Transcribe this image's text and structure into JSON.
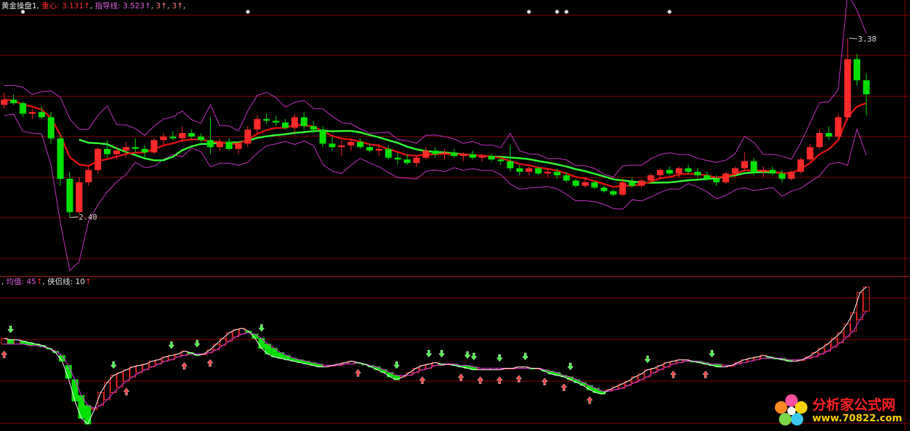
{
  "chart_data": [
    {
      "type": "candlestick",
      "header": {
        "title": "黄金操盘1",
        "items": [
          {
            "label": "重心",
            "value": "3.131",
            "arrow": "↑"
          },
          {
            "label": "指导线",
            "value": "3.523",
            "arrow": "↑"
          },
          {
            "label": "",
            "value": "3",
            "arrow": "↑"
          },
          {
            "label": "",
            "value": "3",
            "arrow": "↑"
          }
        ]
      },
      "annotations": {
        "low": "2.40",
        "high": "3.38"
      },
      "ylim": [
        2.1,
        3.55
      ],
      "grid": true,
      "ohlc": [
        [
          3.04,
          3.11,
          3.02,
          3.07
        ],
        [
          3.07,
          3.1,
          3.04,
          3.05
        ],
        [
          3.05,
          3.06,
          2.97,
          2.99
        ],
        [
          2.99,
          3.02,
          2.96,
          3.0
        ],
        [
          3.0,
          3.03,
          2.96,
          2.97
        ],
        [
          2.97,
          3.0,
          2.82,
          2.85
        ],
        [
          2.85,
          2.87,
          2.58,
          2.62
        ],
        [
          2.62,
          2.66,
          2.4,
          2.43
        ],
        [
          2.43,
          2.63,
          2.42,
          2.6
        ],
        [
          2.6,
          2.7,
          2.58,
          2.67
        ],
        [
          2.67,
          2.8,
          2.65,
          2.79
        ],
        [
          2.79,
          2.84,
          2.74,
          2.76
        ],
        [
          2.76,
          2.8,
          2.73,
          2.78
        ],
        [
          2.78,
          2.83,
          2.74,
          2.8
        ],
        [
          2.8,
          2.85,
          2.77,
          2.79
        ],
        [
          2.79,
          2.81,
          2.74,
          2.77
        ],
        [
          2.77,
          2.85,
          2.76,
          2.84
        ],
        [
          2.84,
          2.88,
          2.81,
          2.86
        ],
        [
          2.86,
          2.89,
          2.84,
          2.85
        ],
        [
          2.85,
          2.92,
          2.83,
          2.88
        ],
        [
          2.88,
          2.9,
          2.85,
          2.86
        ],
        [
          2.86,
          2.88,
          2.83,
          2.84
        ],
        [
          2.84,
          2.97,
          2.76,
          2.8
        ],
        [
          2.8,
          2.85,
          2.78,
          2.83
        ],
        [
          2.83,
          2.85,
          2.78,
          2.79
        ],
        [
          2.79,
          2.83,
          2.76,
          2.82
        ],
        [
          2.82,
          2.92,
          2.8,
          2.9
        ],
        [
          2.9,
          2.98,
          2.88,
          2.96
        ],
        [
          2.96,
          2.99,
          2.93,
          2.95
        ],
        [
          2.95,
          2.98,
          2.92,
          2.94
        ],
        [
          2.94,
          2.96,
          2.9,
          2.91
        ],
        [
          2.91,
          2.99,
          2.88,
          2.97
        ],
        [
          2.97,
          3.0,
          2.9,
          2.92
        ],
        [
          2.92,
          2.95,
          2.88,
          2.9
        ],
        [
          2.9,
          2.92,
          2.8,
          2.82
        ],
        [
          2.82,
          2.86,
          2.78,
          2.8
        ],
        [
          2.8,
          2.84,
          2.75,
          2.81
        ],
        [
          2.81,
          2.85,
          2.78,
          2.83
        ],
        [
          2.83,
          2.85,
          2.79,
          2.8
        ],
        [
          2.8,
          2.82,
          2.77,
          2.78
        ],
        [
          2.78,
          2.82,
          2.75,
          2.79
        ],
        [
          2.79,
          2.81,
          2.73,
          2.74
        ],
        [
          2.74,
          2.77,
          2.7,
          2.73
        ],
        [
          2.73,
          2.76,
          2.7,
          2.71
        ],
        [
          2.71,
          2.75,
          2.69,
          2.74
        ],
        [
          2.74,
          2.8,
          2.73,
          2.78
        ],
        [
          2.78,
          2.8,
          2.74,
          2.76
        ],
        [
          2.76,
          2.79,
          2.73,
          2.77
        ],
        [
          2.77,
          2.79,
          2.74,
          2.75
        ],
        [
          2.75,
          2.77,
          2.72,
          2.76
        ],
        [
          2.76,
          2.78,
          2.73,
          2.74
        ],
        [
          2.74,
          2.76,
          2.72,
          2.75
        ],
        [
          2.75,
          2.76,
          2.72,
          2.73
        ],
        [
          2.73,
          2.74,
          2.7,
          2.72
        ],
        [
          2.72,
          2.81,
          2.66,
          2.68
        ],
        [
          2.68,
          2.7,
          2.64,
          2.66
        ],
        [
          2.66,
          2.69,
          2.64,
          2.68
        ],
        [
          2.68,
          2.69,
          2.64,
          2.65
        ],
        [
          2.65,
          2.68,
          2.63,
          2.66
        ],
        [
          2.66,
          2.68,
          2.62,
          2.64
        ],
        [
          2.64,
          2.66,
          2.6,
          2.61
        ],
        [
          2.61,
          2.62,
          2.57,
          2.58
        ],
        [
          2.58,
          2.62,
          2.57,
          2.6
        ],
        [
          2.6,
          2.61,
          2.56,
          2.57
        ],
        [
          2.57,
          2.58,
          2.54,
          2.55
        ],
        [
          2.55,
          2.56,
          2.52,
          2.53
        ],
        [
          2.53,
          2.62,
          2.52,
          2.6
        ],
        [
          2.6,
          2.63,
          2.57,
          2.58
        ],
        [
          2.58,
          2.62,
          2.57,
          2.61
        ],
        [
          2.61,
          2.65,
          2.6,
          2.64
        ],
        [
          2.64,
          2.68,
          2.62,
          2.67
        ],
        [
          2.67,
          2.69,
          2.64,
          2.65
        ],
        [
          2.65,
          2.69,
          2.63,
          2.68
        ],
        [
          2.68,
          2.7,
          2.65,
          2.66
        ],
        [
          2.66,
          2.68,
          2.63,
          2.64
        ],
        [
          2.64,
          2.66,
          2.61,
          2.62
        ],
        [
          2.62,
          2.64,
          2.58,
          2.6
        ],
        [
          2.6,
          2.66,
          2.59,
          2.65
        ],
        [
          2.65,
          2.69,
          2.63,
          2.68
        ],
        [
          2.68,
          2.77,
          2.66,
          2.72
        ],
        [
          2.72,
          2.74,
          2.64,
          2.66
        ],
        [
          2.66,
          2.69,
          2.63,
          2.67
        ],
        [
          2.67,
          2.69,
          2.64,
          2.65
        ],
        [
          2.65,
          2.67,
          2.6,
          2.62
        ],
        [
          2.62,
          2.67,
          2.61,
          2.66
        ],
        [
          2.66,
          2.74,
          2.65,
          2.73
        ],
        [
          2.73,
          2.82,
          2.72,
          2.8
        ],
        [
          2.8,
          2.9,
          2.79,
          2.88
        ],
        [
          2.88,
          2.92,
          2.84,
          2.86
        ],
        [
          2.86,
          2.99,
          2.85,
          2.97
        ],
        [
          2.97,
          3.42,
          2.95,
          3.3
        ],
        [
          3.3,
          3.33,
          3.15,
          3.18
        ],
        [
          3.18,
          3.22,
          2.98,
          3.1
        ]
      ]
    },
    {
      "type": "line",
      "header": {
        "items": [
          {
            "label": "均值",
            "value": "45",
            "arrow": "↑"
          },
          {
            "label": "侠侣线",
            "value": "10",
            "arrow": "↑"
          }
        ]
      },
      "ylim": [
        0,
        100
      ],
      "grid": true,
      "series": [
        {
          "values": [
            62,
            61,
            61,
            60,
            59,
            58,
            57,
            55,
            52,
            46,
            34,
            18,
            6,
            2,
            12,
            24,
            31,
            36,
            38,
            40,
            42,
            43,
            44,
            46,
            47,
            49,
            50,
            51,
            53,
            52,
            50,
            51,
            54,
            58,
            62,
            66,
            68,
            69,
            67,
            62,
            55,
            51,
            49,
            48,
            47,
            46,
            45,
            44,
            43,
            42,
            42,
            43,
            44,
            45,
            46,
            45,
            44,
            42,
            40,
            38,
            35,
            33,
            35,
            38,
            41,
            43,
            44,
            45,
            44,
            44,
            43,
            42,
            41,
            40,
            40,
            40,
            40,
            40,
            41,
            41,
            42,
            42,
            41,
            41,
            39,
            37,
            36,
            35,
            33,
            31,
            29,
            26,
            24,
            23,
            26,
            28,
            30,
            32,
            35,
            37,
            40,
            41,
            43,
            45,
            46,
            47,
            47,
            46,
            45,
            44,
            43,
            42,
            42,
            43,
            45,
            47,
            48,
            49,
            50,
            49,
            48,
            47,
            46,
            46,
            47,
            49,
            52,
            55,
            58,
            62,
            66,
            72,
            80,
            94,
            98
          ]
        },
        {
          "values": [
            58,
            58,
            58,
            58,
            57,
            57,
            56,
            55,
            53,
            50,
            43,
            33,
            22,
            15,
            13,
            15,
            19,
            24,
            28,
            32,
            35,
            38,
            40,
            42,
            44,
            46,
            47,
            49,
            50,
            51,
            51,
            51,
            52,
            54,
            57,
            60,
            63,
            65,
            66,
            65,
            62,
            58,
            55,
            52,
            50,
            48,
            47,
            46,
            45,
            44,
            43,
            43,
            43,
            44,
            44,
            45,
            44,
            43,
            42,
            40,
            38,
            36,
            36,
            36,
            38,
            40,
            41,
            43,
            43,
            44,
            44,
            43,
            43,
            42,
            41,
            41,
            41,
            41,
            41,
            41,
            41,
            41,
            41,
            41,
            40,
            39,
            38,
            36,
            35,
            33,
            31,
            29,
            27,
            25,
            25,
            26,
            27,
            29,
            31,
            33,
            35,
            38,
            40,
            42,
            44,
            45,
            46,
            46,
            46,
            45,
            44,
            44,
            43,
            43,
            44,
            45,
            46,
            47,
            48,
            48,
            48,
            48,
            47,
            47,
            47,
            48,
            49,
            51,
            53,
            56,
            59,
            63,
            67,
            75,
            81
          ]
        }
      ],
      "buy_signals": [
        0,
        13,
        19,
        28,
        32,
        55,
        65,
        71,
        74,
        77,
        80,
        84,
        87,
        91,
        104,
        109
      ],
      "sell_signals": [
        1,
        17,
        26,
        30,
        40,
        61,
        66,
        68,
        72,
        73,
        77,
        81,
        88,
        100,
        110
      ]
    }
  ],
  "top_markers": [
    2,
    26,
    56,
    59,
    60,
    71
  ],
  "colors": {
    "up": "#ff2a2a",
    "down": "#00e000",
    "ma_green": "#33ff33",
    "ma_red": "#e01010",
    "band": "#cc33cc",
    "grid": "#8b0000",
    "osc_main": "#ffffff",
    "osc_signal": "#cc33cc"
  },
  "watermark": {
    "name": "分析家公式网",
    "url": "www.70822.com"
  }
}
